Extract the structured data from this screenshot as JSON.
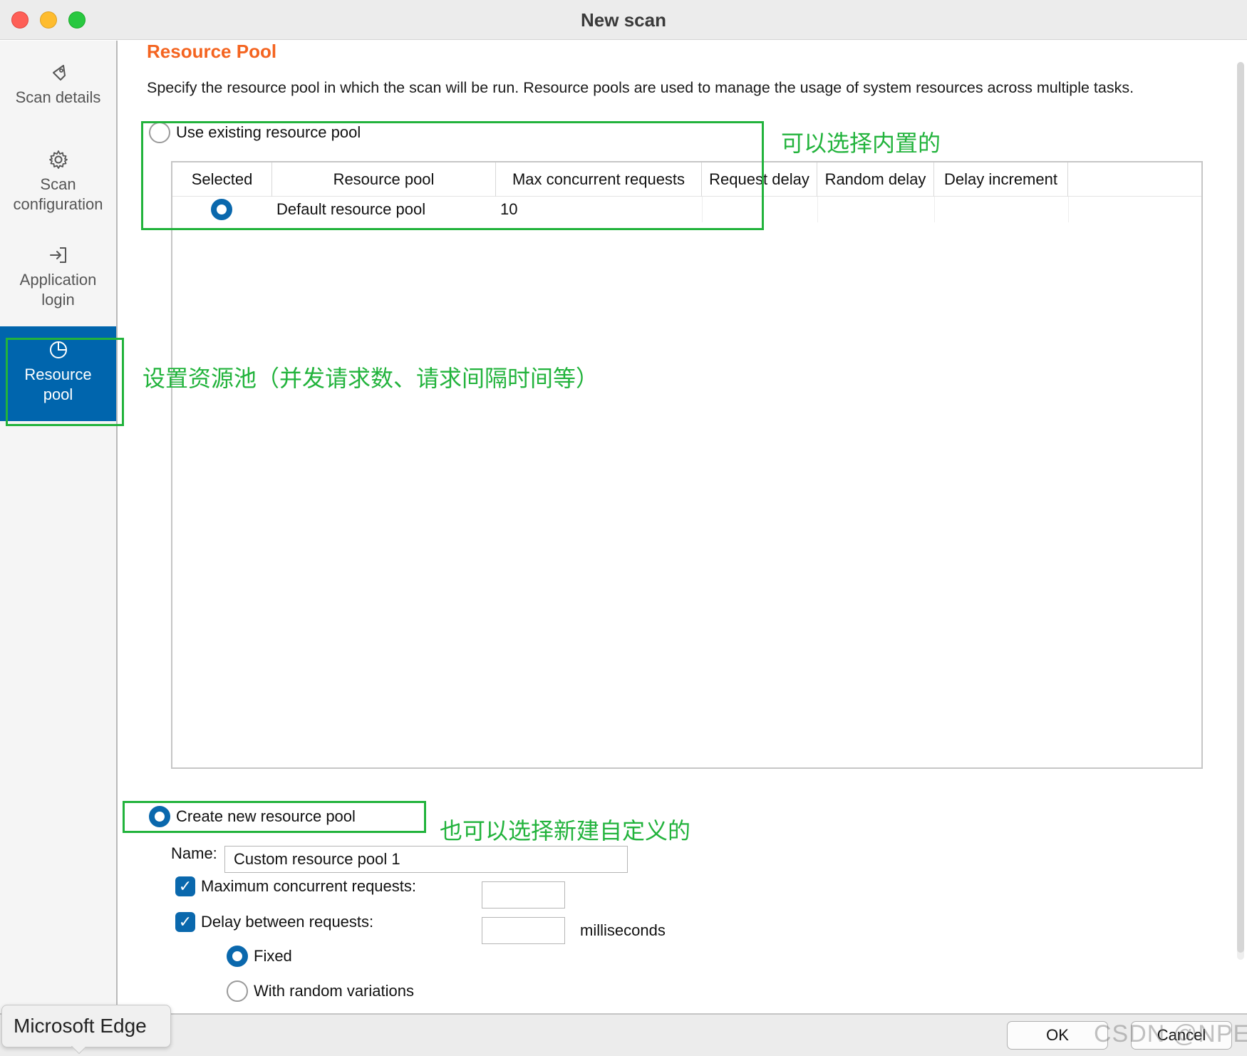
{
  "window": {
    "title": "New scan"
  },
  "sidebar": {
    "items": [
      {
        "label_lines": [
          "Scan details"
        ],
        "icon": "tag-icon"
      },
      {
        "label_lines": [
          "Scan",
          "configuration"
        ],
        "icon": "gear-icon"
      },
      {
        "label_lines": [
          "Application",
          "login"
        ],
        "icon": "login-arrow-icon"
      },
      {
        "label_lines": [
          "Resource",
          "pool"
        ],
        "icon": "pie-chart-icon",
        "active": true
      }
    ]
  },
  "main": {
    "title": "Resource Pool",
    "description": "Specify the resource pool in which the scan will be run. Resource pools are used to manage the usage of system resources across multiple tasks.",
    "existing_option": {
      "label": "Use existing resource pool",
      "selected": false
    },
    "table": {
      "headers": [
        "Selected",
        "Resource pool",
        "Max concurrent requests",
        "Request delay",
        "Random delay",
        "Delay increment"
      ],
      "rows": [
        {
          "selected": true,
          "resource_pool": "Default resource pool",
          "max_concurrent_requests": "10",
          "request_delay": "",
          "random_delay": "",
          "delay_increment": ""
        }
      ]
    },
    "create_option": {
      "label": "Create new resource pool",
      "selected": true
    },
    "name_field": {
      "label": "Name:",
      "value": "Custom resource pool 1"
    },
    "max_concurrent": {
      "label": "Maximum concurrent requests:",
      "checked": true,
      "value": ""
    },
    "delay": {
      "label": "Delay between requests:",
      "checked": true,
      "value": "",
      "unit": "milliseconds"
    },
    "delay_modes": [
      {
        "label": "Fixed",
        "selected": true
      },
      {
        "label": "With random variations",
        "selected": false
      }
    ]
  },
  "annotations": {
    "builtin_note": "可以选择内置的",
    "resource_pool_note": "设置资源池（并发请求数、请求间隔时间等）",
    "custom_note": "也可以选择新建自定义的",
    "color": "#22b33c"
  },
  "footer": {
    "ok_label": "OK",
    "cancel_label": "Cancel"
  },
  "tooltip": {
    "text": "Microsoft Edge"
  },
  "watermark": "CSDN @NPE~",
  "colors": {
    "accent": "#0065ad",
    "title_orange": "#f46420"
  }
}
